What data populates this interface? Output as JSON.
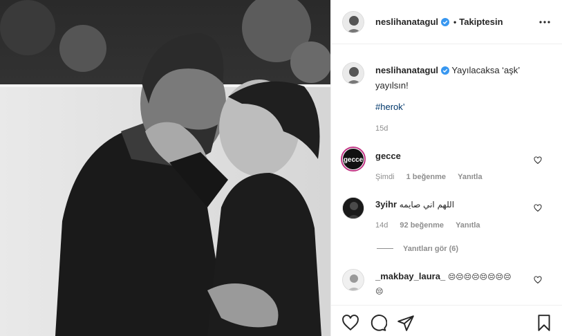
{
  "post": {
    "author": "neslihanatagul",
    "follow_label": "Takiptesin",
    "separator": "•",
    "caption_line1": "Yayılacaksa ‘aşk’",
    "caption_line2": "yayılsın!",
    "caption_emoji": "",
    "hashtag": "#herok",
    "hashtag_suffix": "’",
    "time": "15d"
  },
  "comments": [
    {
      "username": "gecce",
      "text": "",
      "time": "Şimdi",
      "likes": "1 beğenme",
      "reply": "Yanıtla",
      "avatar_text": "gecce"
    },
    {
      "username": "3yihr",
      "text": "اللهم اني صايمه",
      "time": "14d",
      "likes": "92 beğenme",
      "reply": "Yanıtla",
      "view_replies": "Yanıtları gör (6)"
    },
    {
      "username": "_makbay_laura_",
      "text": "😔😔😔😔😔😔😔😔",
      "text2": "😔"
    }
  ],
  "icons": {
    "more": "more-options-icon",
    "like": "heart-icon",
    "comment": "comment-icon",
    "share": "share-icon",
    "save": "bookmark-icon"
  },
  "colors": {
    "verified": "#3897f0",
    "hashtag": "#00376b",
    "meta": "#8e8e8e"
  }
}
